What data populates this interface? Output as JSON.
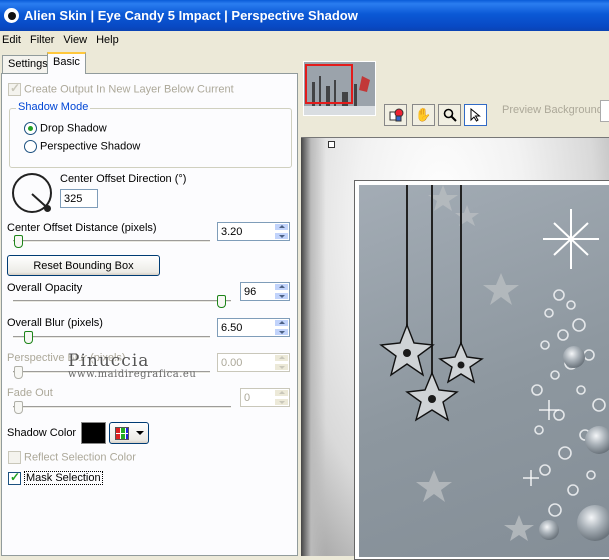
{
  "window": {
    "title": "Alien Skin | Eye Candy 5 Impact | Perspective Shadow"
  },
  "menu": [
    "Edit",
    "Filter",
    "View",
    "Help"
  ],
  "tabs": {
    "settings": "Settings",
    "basic": "Basic"
  },
  "basic": {
    "create_output": "Create Output In New Layer Below Current",
    "shadow_mode_legend": "Shadow Mode",
    "drop_shadow": "Drop Shadow",
    "perspective_shadow": "Perspective Shadow",
    "center_offset_direction_label": "Center Offset Direction (°)",
    "center_offset_direction_value": "325",
    "center_offset_distance_label": "Center Offset Distance (pixels)",
    "center_offset_distance_value": "3.20",
    "reset_bounding_box": "Reset Bounding Box",
    "overall_opacity_label": "Overall Opacity",
    "overall_opacity_value": "96",
    "overall_blur_label": "Overall Blur (pixels)",
    "overall_blur_value": "6.50",
    "perspective_blur_label": "Perspective Blur (pixels)",
    "perspective_blur_value": "0.00",
    "fade_out_label": "Fade Out",
    "fade_out_value": "0",
    "shadow_color_label": "Shadow Color",
    "shadow_color": "#000000",
    "reflect_selection_color": "Reflect Selection Color",
    "mask_selection": "Mask Selection"
  },
  "watermark": {
    "name": "Pinuccia",
    "url": "www.maidiregrafica.eu"
  },
  "preview": {
    "background_label": "Preview Background:",
    "tools": [
      "hand-icon",
      "zoom-icon",
      "pointer-icon"
    ]
  },
  "sliders": {
    "center_offset_distance": 0.0,
    "overall_opacity": 0.96,
    "overall_blur": 0.06,
    "perspective_blur": 0.0,
    "fade_out": 0.0
  }
}
